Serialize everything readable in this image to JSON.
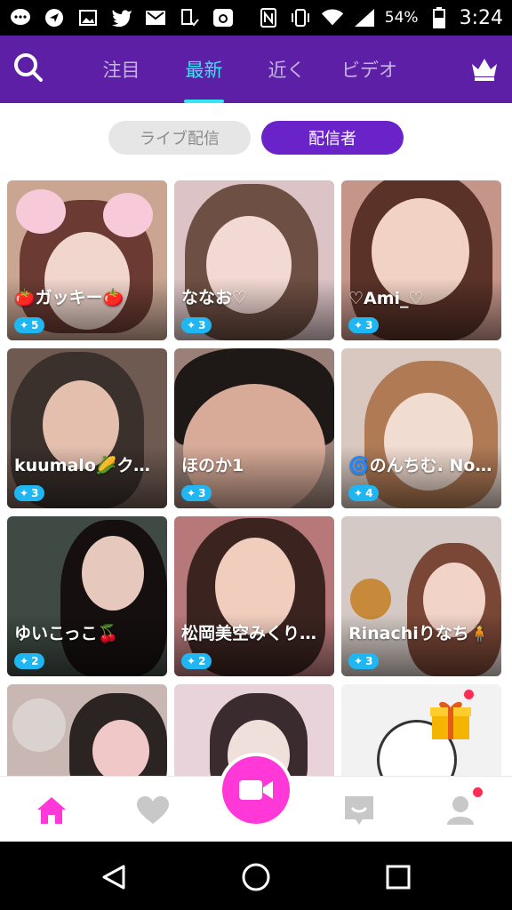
{
  "status_bar": {
    "battery": "54%",
    "time": "3:24",
    "icons": [
      "chat-icon",
      "send-icon",
      "image-icon",
      "twitter-icon",
      "mail-icon",
      "sim-icon",
      "camera-icon",
      "nfc-icon",
      "vibrate-icon",
      "wifi-icon",
      "signal-icon",
      "battery-icon"
    ]
  },
  "header": {
    "tabs": [
      {
        "label": "注目",
        "active": false
      },
      {
        "label": "最新",
        "active": true
      },
      {
        "label": "近く",
        "active": false
      },
      {
        "label": "ビデオ",
        "active": false
      }
    ],
    "accent": "#35e6f0",
    "bg": "#5c1fa5"
  },
  "segments": {
    "live": "ライブ配信",
    "broadcaster": "配信者"
  },
  "cards": [
    {
      "name": "🍅ガッキー🍅",
      "level": "5",
      "bg": "#c9a592"
    },
    {
      "name": "ななお♡",
      "level": "3",
      "bg": "#dcc4c6"
    },
    {
      "name": "♡Ami_♡",
      "level": "3",
      "bg": "#c6958a"
    },
    {
      "name": "kuumalo🌽クル…",
      "level": "3",
      "bg": "#6f5a52"
    },
    {
      "name": "ほのか1",
      "level": "3",
      "bg": "#9a8078"
    },
    {
      "name": "🌀のんちむ. No…",
      "level": "4",
      "bg": "#d9c8bf"
    },
    {
      "name": "ゆいこっこ🍒",
      "level": "2",
      "bg": "#3f4a44"
    },
    {
      "name": "松岡美空みくり…",
      "level": "2",
      "bg": "#b7787a"
    },
    {
      "name": "Rinachiりなち🧍",
      "level": "3",
      "bg": "#d4c9c4"
    },
    {
      "name": "",
      "level": "",
      "bg": "#c8b7b3"
    },
    {
      "name": "",
      "level": "",
      "bg": "#e7d3d9"
    },
    {
      "name": "",
      "level": "",
      "bg": "#f2f2f2"
    }
  ],
  "bottom_nav": {
    "items": [
      "home-icon",
      "favorites-icon",
      "record-video-icon",
      "messages-icon",
      "profile-icon"
    ],
    "active_color": "#ff38d7",
    "inactive_color": "#c8c8c8"
  }
}
